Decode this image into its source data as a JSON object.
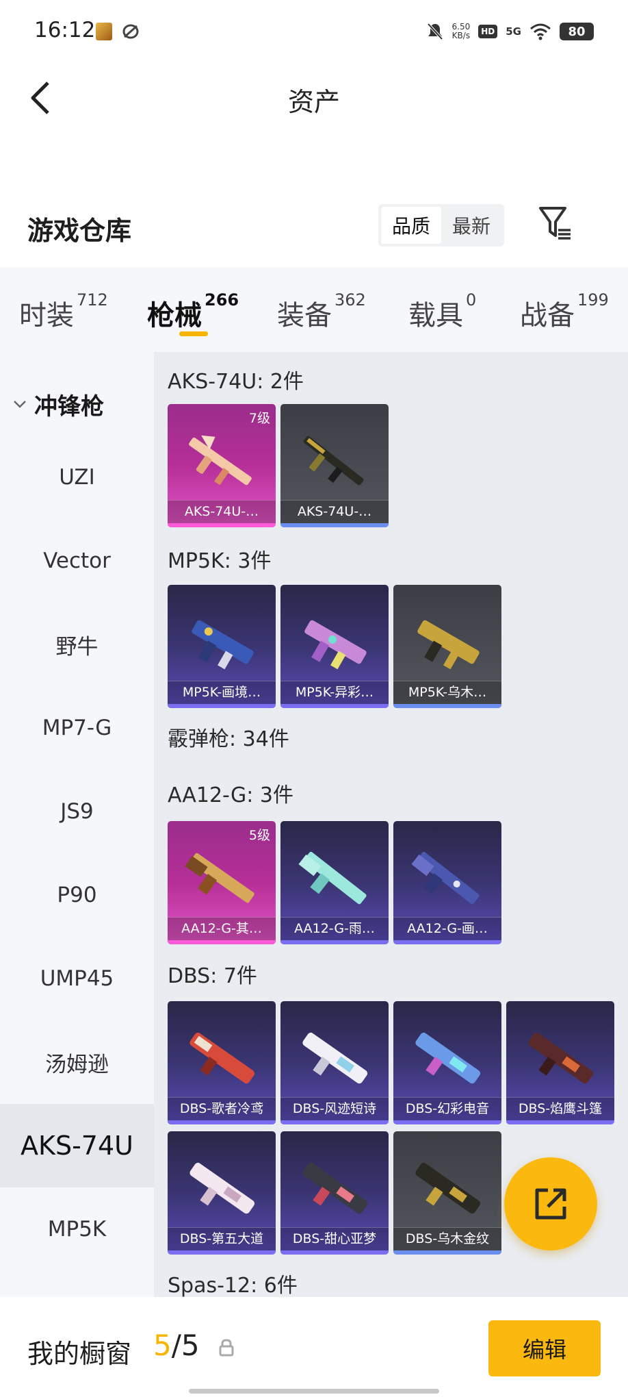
{
  "status_bar": {
    "time": "16:12",
    "net_speed_value": "6.50",
    "net_speed_unit": "KB/s",
    "hd": "HD",
    "network": "5G",
    "battery": "80",
    "icons": [
      "app-notification-icon",
      "sync-icon",
      "mute-icon",
      "signal-icon",
      "wifi-icon",
      "battery-icon"
    ]
  },
  "header": {
    "title": "资产",
    "back_icon": "chevron-left-icon"
  },
  "warehouse": {
    "title": "游戏仓库",
    "sort_options": [
      "品质",
      "最新"
    ],
    "selected_sort": "品质",
    "filter_icon": "filter-icon"
  },
  "tabs": [
    {
      "label": "时装",
      "count": "712"
    },
    {
      "label": "枪械",
      "count": "266"
    },
    {
      "label": "装备",
      "count": "362"
    },
    {
      "label": "载具",
      "count": "0"
    },
    {
      "label": "战备",
      "count": "199"
    }
  ],
  "active_tab": "枪械",
  "sidebar": {
    "group": "冲锋枪",
    "items": [
      "UZI",
      "Vector",
      "野牛",
      "MP7-G",
      "JS9",
      "P90",
      "UMP45",
      "汤姆逊",
      "AKS-74U",
      "MP5K"
    ],
    "active_item": "AKS-74U"
  },
  "sections": [
    {
      "title": "AKS-74U: 2件",
      "items": [
        {
          "name": "AKS-74U-…",
          "rarity": "legendary",
          "level": "7级"
        },
        {
          "name": "AKS-74U-…",
          "rarity": "common",
          "level": ""
        }
      ]
    },
    {
      "title": "MP5K: 3件",
      "items": [
        {
          "name": "MP5K-画境…",
          "rarity": "epic",
          "level": ""
        },
        {
          "name": "MP5K-异彩…",
          "rarity": "epic",
          "level": ""
        },
        {
          "name": "MP5K-乌木…",
          "rarity": "common",
          "level": ""
        }
      ]
    },
    {
      "title": "霰弹枪: 34件",
      "items": []
    },
    {
      "title": "AA12-G: 3件",
      "items": [
        {
          "name": "AA12-G-其…",
          "rarity": "legendary",
          "level": "5级"
        },
        {
          "name": "AA12-G-雨…",
          "rarity": "epic",
          "level": ""
        },
        {
          "name": "AA12-G-画…",
          "rarity": "epic",
          "level": ""
        }
      ]
    },
    {
      "title": "DBS: 7件",
      "items": [
        {
          "name": "DBS-歌者冷鸢",
          "rarity": "epic",
          "level": ""
        },
        {
          "name": "DBS-风迹短诗",
          "rarity": "epic",
          "level": ""
        },
        {
          "name": "DBS-幻彩电音",
          "rarity": "epic",
          "level": ""
        },
        {
          "name": "DBS-焰鹰斗篷",
          "rarity": "epic",
          "level": ""
        },
        {
          "name": "DBS-第五大道",
          "rarity": "epic",
          "level": ""
        },
        {
          "name": "DBS-甜心亚梦",
          "rarity": "epic",
          "level": ""
        },
        {
          "name": "DBS-乌木金纹",
          "rarity": "common",
          "level": ""
        }
      ]
    },
    {
      "title": "Spas-12: 6件",
      "items": []
    }
  ],
  "fab": {
    "icon": "share-external-icon",
    "color": "#fbb80f"
  },
  "bottom_bar": {
    "label": "我的橱窗",
    "count_current": "5",
    "count_sep": "/",
    "count_total": "5",
    "lock_icon": "lock-icon",
    "edit_label": "编辑"
  },
  "colors": {
    "accent": "#fbb80f",
    "tab_underline": "#f7b500",
    "legendary": "#e456c6",
    "epic": "#5a4cb8",
    "common": "#55575e"
  }
}
